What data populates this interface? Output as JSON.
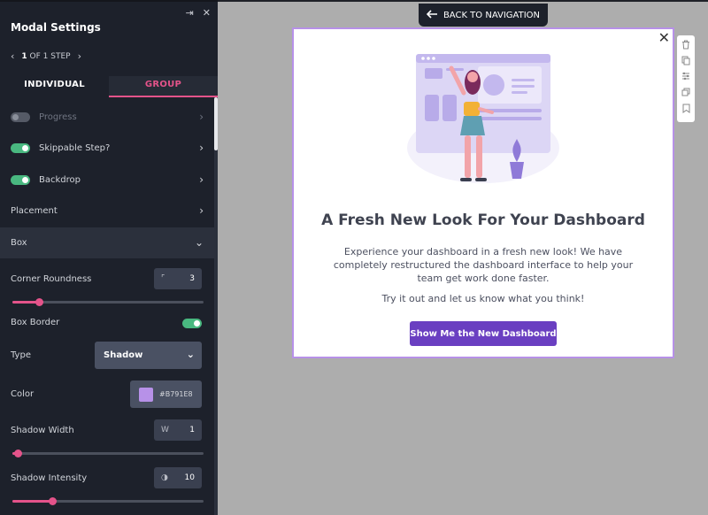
{
  "sidebar": {
    "title": "Modal Settings",
    "step": {
      "current": "1",
      "text": "OF 1 STEP"
    },
    "tabs": {
      "individual": "INDIVIDUAL",
      "group": "GROUP"
    },
    "rows": {
      "progress": "Progress",
      "skippable": "Skippable Step?",
      "backdrop": "Backdrop",
      "placement": "Placement",
      "box": "Box"
    },
    "box": {
      "corner_label": "Corner Roundness",
      "corner_value": "3",
      "corner_slider_fraction": 0.14,
      "border_label": "Box Border",
      "type_label": "Type",
      "type_value": "Shadow",
      "color_label": "Color",
      "color_value": "#B791E8",
      "shadow_width_label": "Shadow Width",
      "shadow_width_prefix": "W",
      "shadow_width_value": "1",
      "shadow_width_fraction": 0.03,
      "shadow_intensity_label": "Shadow Intensity",
      "shadow_intensity_value": "10",
      "shadow_intensity_fraction": 0.21
    }
  },
  "canvas": {
    "back_label": "BACK TO NAVIGATION",
    "modal": {
      "title": "A Fresh New Look For Your Dashboard",
      "body": "Experience your dashboard in a fresh new look! We have completely restructured the dashboard interface to help your team get work done faster.",
      "body2": "Try it out and let us know what you think!",
      "cta": "Show Me the New Dashboard"
    }
  },
  "colors": {
    "accent_pink": "#e4538a",
    "toggle_on": "#49b880",
    "cta_purple": "#6a3fc1",
    "modal_border": "#b791e8"
  },
  "icons": [
    "collapse-icon",
    "close-icon",
    "chevron-left-icon",
    "chevron-right-icon",
    "chevron-down-icon",
    "arrow-left-icon",
    "trash-icon",
    "copy-icon",
    "settings-sliders-icon",
    "duplicate-icon",
    "bookmark-icon"
  ]
}
